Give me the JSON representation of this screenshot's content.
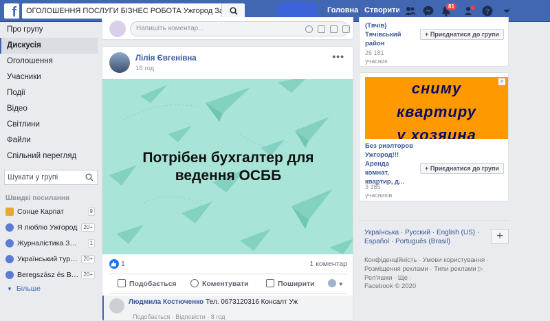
{
  "topbar": {
    "search_value": "ОГОЛОШЕННЯ ПОСЛУГИ БІЗНЕС РОБОТА Ужгород Закарпаття",
    "home_label": "Головна",
    "create_label": "Створити",
    "notif_count": "81"
  },
  "sidebar": {
    "items": [
      {
        "label": "Про групу"
      },
      {
        "label": "Дискусія"
      },
      {
        "label": "Оголошення"
      },
      {
        "label": "Учасники"
      },
      {
        "label": "Події"
      },
      {
        "label": "Відео"
      },
      {
        "label": "Світлини"
      },
      {
        "label": "Файли"
      },
      {
        "label": "Спільний перегляд"
      }
    ],
    "search_placeholder": "Шукати у групі",
    "shortcuts_title": "Швидкі посилання",
    "shortcuts": [
      {
        "label": "Сонце Карпат",
        "count": "9"
      },
      {
        "label": "Я люблю Ужгород",
        "count": "20+"
      },
      {
        "label": "Журналістика Закарпаття",
        "count": "1"
      },
      {
        "label": "Український туризм",
        "count": "20+"
      },
      {
        "label": "Beregszász és Beregvidék",
        "count": "20+"
      }
    ],
    "more_label": "Більше"
  },
  "feed": {
    "comment_placeholder": "Напишіть коментар...",
    "post": {
      "author": "Лілія Євгенівна",
      "time": "18 год",
      "image_text_line1": "Потрібен бухгалтер для",
      "image_text_line2": "ведення ОСББ",
      "likes": "1",
      "comments": "1 коментар",
      "actions": {
        "like": "Подобається",
        "comment": "Коментувати",
        "share": "Поширити"
      },
      "comment": {
        "name": "Людмила Костюченко",
        "text": "Тел. 0673120316 Консалт Уж",
        "meta": "Подобається · Відповісти · 8 год"
      }
    }
  },
  "right": {
    "group1": {
      "title_line1": "(Тячів)",
      "title_line2": "Тячівський",
      "title_line3": "район",
      "members": "26 181",
      "members_label": "учасник",
      "join": "Приєднатися до групи"
    },
    "ad": {
      "line1": "сниму",
      "line2": "квартиру",
      "line3": "у хозяина"
    },
    "group2": {
      "title_line1": "Без риэлторов",
      "title_line2": "Ужгород!!!",
      "title_line3": "Аренда",
      "title_line4": "комнат,",
      "title_line5": "квартир, д...",
      "members": "3 185",
      "members_label": "учасників",
      "join": "Приєднатися до групи"
    },
    "languages_line1": "Українська · Русский · English (US) ·",
    "languages_line2": "Español · Português (Brasil)",
    "footer_line1": "Конфіденційність · Умови користування ·",
    "footer_line2": "Розміщення реклами · Типи реклами ▷",
    "footer_line3": "Реп'яшки · Ще ·",
    "footer_line4": "Facebook © 2020"
  }
}
